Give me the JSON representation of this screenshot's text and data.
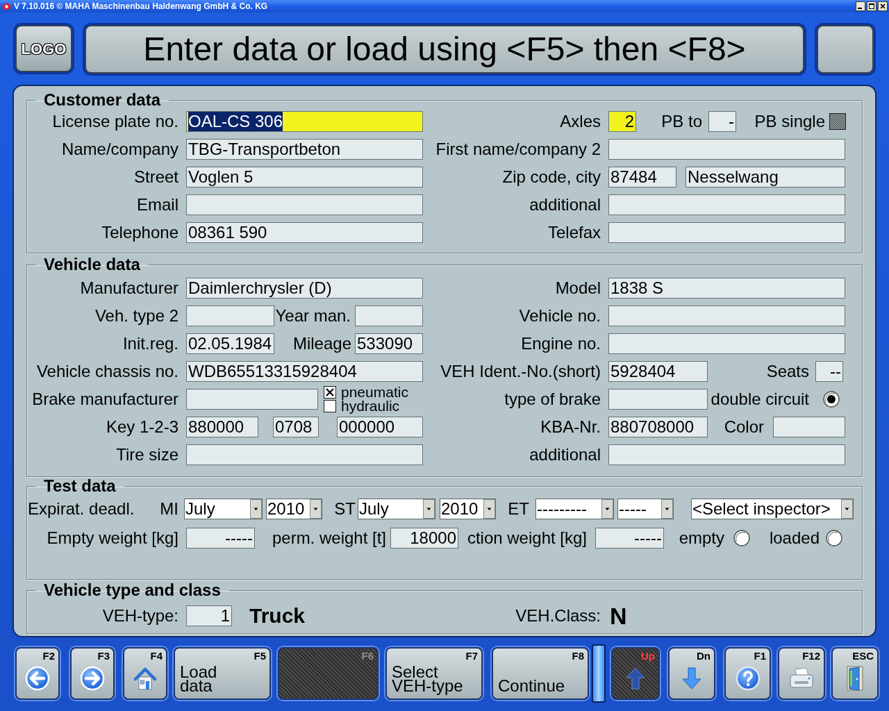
{
  "window": {
    "title": "V 7.10.016 © MAHA Maschinenbau Haldenwang GmbH & Co. KG"
  },
  "header": {
    "logo": "LOGO",
    "message": "Enter data or load using <F5> then <F8>"
  },
  "customer_data": {
    "title": "Customer data",
    "rows": [
      {
        "left": [
          {
            "label": "License plate no.",
            "kind": "field",
            "value": "OAL-CS 306",
            "highlighted": true,
            "text_selected": true
          }
        ],
        "right": [
          {
            "label": "Axles",
            "kind": "field",
            "value": "2",
            "highlighted": true
          },
          {
            "label": "PB to",
            "kind": "field",
            "value": "-"
          },
          {
            "label": "PB single",
            "kind": "checkbox",
            "checked": false,
            "disabled": true
          }
        ]
      },
      {
        "left": [
          {
            "label": "Name/company",
            "kind": "field",
            "value": "TBG-Transportbeton"
          }
        ],
        "right": [
          {
            "label": "First name/company 2",
            "kind": "field"
          }
        ]
      },
      {
        "left": [
          {
            "label": "Street",
            "kind": "field",
            "value": "Voglen 5"
          }
        ],
        "right": [
          {
            "label": "Zip code, city",
            "kind": "fields",
            "fields": [
              {
                "value": "87484"
              },
              {
                "value": "Nesselwang"
              }
            ]
          }
        ]
      },
      {
        "left": [
          {
            "label": "Email",
            "kind": "field"
          }
        ],
        "right": [
          {
            "label": "additional",
            "kind": "field"
          }
        ]
      },
      {
        "left": [
          {
            "label": "Telephone",
            "kind": "field",
            "value": "08361 590"
          }
        ],
        "right": [
          {
            "label": "Telefax",
            "kind": "field"
          }
        ]
      }
    ]
  },
  "vehicle_data": {
    "title": "Vehicle data",
    "rows": [
      {
        "left": [
          {
            "label": "Manufacturer",
            "kind": "field",
            "value": "Daimlerchrysler (D)"
          }
        ],
        "right": [
          {
            "label": "Model",
            "kind": "field",
            "value": "1838 S"
          }
        ]
      },
      {
        "left": [
          {
            "label": "Veh. type 2",
            "kind": "field"
          },
          {
            "label": "Year man.",
            "kind": "field"
          }
        ],
        "right": [
          {
            "label": "Vehicle no.",
            "kind": "field"
          }
        ]
      },
      {
        "left": [
          {
            "label": "Init.reg.",
            "kind": "field",
            "value": "02.05.1984"
          },
          {
            "label": "Mileage",
            "kind": "field",
            "value": "533090"
          }
        ],
        "right": [
          {
            "label": "Engine no.",
            "kind": "field"
          }
        ]
      },
      {
        "left": [
          {
            "label": "Vehicle chassis no.",
            "kind": "field",
            "value": "WDB65513315928404"
          }
        ],
        "right": [
          {
            "label": "VEH Ident.-No.(short)",
            "kind": "field",
            "value": "5928404"
          },
          {
            "label": "Seats",
            "kind": "field",
            "value": "--"
          }
        ]
      },
      {
        "left": [
          {
            "label": "Brake manufacturer",
            "kind": "field"
          },
          {
            "kind": "checkbox_group",
            "options": [
              {
                "label": "pneumatic",
                "checked": true
              },
              {
                "label": "hydraulic",
                "checked": false
              }
            ]
          }
        ],
        "right": [
          {
            "label": "type of brake",
            "kind": "field"
          },
          {
            "label": "double circuit",
            "kind": "radio",
            "selected": true
          }
        ]
      },
      {
        "left": [
          {
            "label": "Key 1-2-3",
            "kind": "fields",
            "fields": [
              {
                "value": "880000"
              },
              {
                "value": "0708"
              },
              {
                "value": "000000"
              }
            ]
          }
        ],
        "right": [
          {
            "label": "KBA-Nr.",
            "kind": "field",
            "value": "880708000"
          },
          {
            "label": "Color",
            "kind": "field"
          }
        ]
      },
      {
        "left": [
          {
            "label": "Tire size",
            "kind": "field"
          }
        ],
        "right": [
          {
            "label": "additional",
            "kind": "field"
          }
        ]
      }
    ]
  },
  "test_data": {
    "title": "Test data",
    "rows": [
      {
        "left": [
          {
            "label": "Expirat. deadl.",
            "kind": "label"
          },
          {
            "label": "MI",
            "kind": "dropdowns",
            "dropdowns": [
              {
                "value": "July"
              },
              {
                "value": "2010"
              }
            ]
          },
          {
            "label": "ST",
            "kind": "dropdowns",
            "dropdowns": [
              {
                "value": "July"
              },
              {
                "value": "2010"
              }
            ]
          }
        ],
        "right": [
          {
            "label": "ET",
            "kind": "dropdowns",
            "dropdowns": [
              {
                "value": "---------"
              },
              {
                "value": "-----"
              }
            ]
          },
          {
            "kind": "dropdown",
            "value": "<Select inspector>"
          }
        ]
      },
      {
        "left": [
          {
            "label": "Empty weight [kg]",
            "kind": "field",
            "value": "-----"
          },
          {
            "label": "perm. weight [t]",
            "kind": "field",
            "value": "18000"
          }
        ],
        "right": [
          {
            "label": "ction weight [kg]",
            "kind": "field",
            "value": "-----"
          },
          {
            "label": "empty",
            "kind": "radio",
            "selected": false
          },
          {
            "label": "loaded",
            "kind": "radio",
            "selected": false
          }
        ]
      }
    ]
  },
  "vehicle_type_and_class": {
    "title": "Vehicle type and class",
    "rows": [
      {
        "left": [
          {
            "label": "VEH-type:",
            "kind": "field",
            "value": "1"
          },
          {
            "kind": "value_text",
            "text": "Truck"
          }
        ],
        "right": [
          {
            "label": "VEH.Class:",
            "kind": "value_text",
            "text": "N"
          }
        ]
      }
    ]
  },
  "function_keys": [
    {
      "key": "F2",
      "disabled": false
    },
    {
      "key": "F3",
      "disabled": false
    },
    {
      "key": "F4",
      "disabled": false
    },
    {
      "key": "F5",
      "label": "Load data",
      "disabled": false
    },
    {
      "key": "F6",
      "disabled": true
    },
    {
      "key": "F7",
      "label": "Select VEH-type",
      "disabled": false
    },
    {
      "key": "F8",
      "label": "Continue",
      "disabled": false
    },
    {
      "key": "Up",
      "disabled": true,
      "color": "#ff4040"
    },
    {
      "key": "Dn",
      "disabled": false
    },
    {
      "key": "F1",
      "disabled": false
    },
    {
      "key": "F12",
      "disabled": false
    },
    {
      "key": "ESC",
      "disabled": false
    }
  ]
}
